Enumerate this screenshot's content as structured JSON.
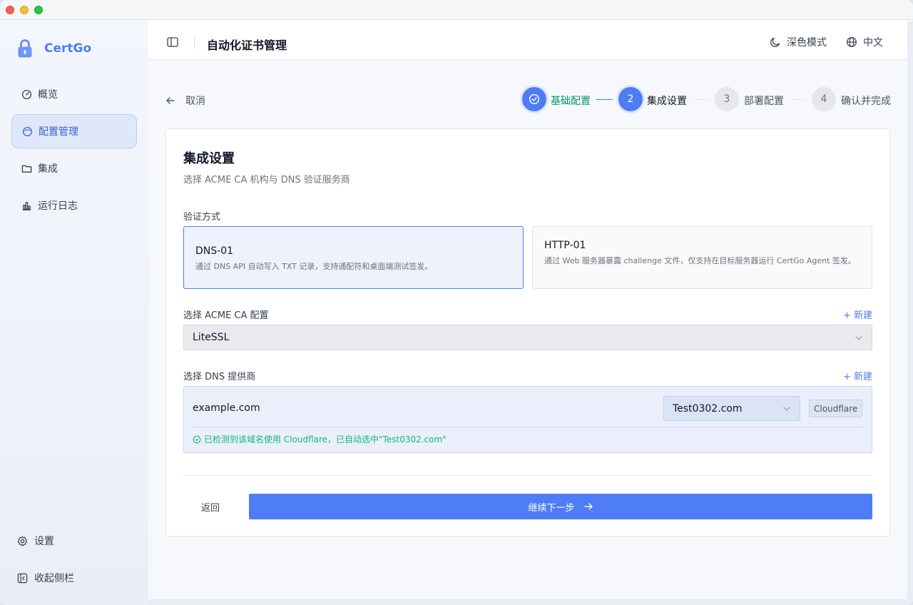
{
  "colors": {
    "accent": "#4f7cf3",
    "success": "#10b981",
    "step_done_label": "#059669",
    "primary_button": "#4f7cf7"
  },
  "sidebar": {
    "brand": "CertGo",
    "items": [
      {
        "label": "概览",
        "icon": "gauge-icon",
        "active": false
      },
      {
        "label": "配置管理",
        "icon": "circle-icon",
        "active": true
      },
      {
        "label": "集成",
        "icon": "folder-icon",
        "active": false
      },
      {
        "label": "运行日志",
        "icon": "bar-chart-icon",
        "active": false
      }
    ],
    "settings_label": "设置",
    "collapse_label": "收起侧栏"
  },
  "header": {
    "title": "自动化证书管理",
    "theme_label": "深色模式",
    "lang_label": "中文"
  },
  "wizard": {
    "cancel_label": "取消",
    "steps": [
      {
        "number": "1",
        "label": "基础配置",
        "status": "done"
      },
      {
        "number": "2",
        "label": "集成设置",
        "status": "current"
      },
      {
        "number": "3",
        "label": "部署配置",
        "status": "pending"
      },
      {
        "number": "4",
        "label": "确认并完成",
        "status": "pending"
      }
    ]
  },
  "form": {
    "title": "集成设置",
    "subtitle": "选择 ACME CA 机构与 DNS 验证服务商",
    "method_label": "验证方式",
    "methods": [
      {
        "name": "DNS-01",
        "desc": "通过 DNS API 自动写入 TXT 记录，支持通配符和桌面端测试签发。",
        "selected": true
      },
      {
        "name": "HTTP-01",
        "desc": "通过 Web 服务器暴露 challenge 文件，仅支持在目标服务器运行 CertGo Agent 签发。",
        "selected": false
      }
    ],
    "ca_label": "选择 ACME CA 配置",
    "ca_new": "新建",
    "ca_value": "LiteSSL",
    "dns_label": "选择 DNS 提供商",
    "dns_new": "新建",
    "dns": {
      "domain": "example.com",
      "provider_value": "Test0302.com",
      "provider_type": "Cloudflare",
      "detect_msg": "已检测到该域名使用 Cloudflare，已自动选中\"Test0302.com\""
    },
    "back_label": "返回",
    "next_label": "继续下一步"
  }
}
